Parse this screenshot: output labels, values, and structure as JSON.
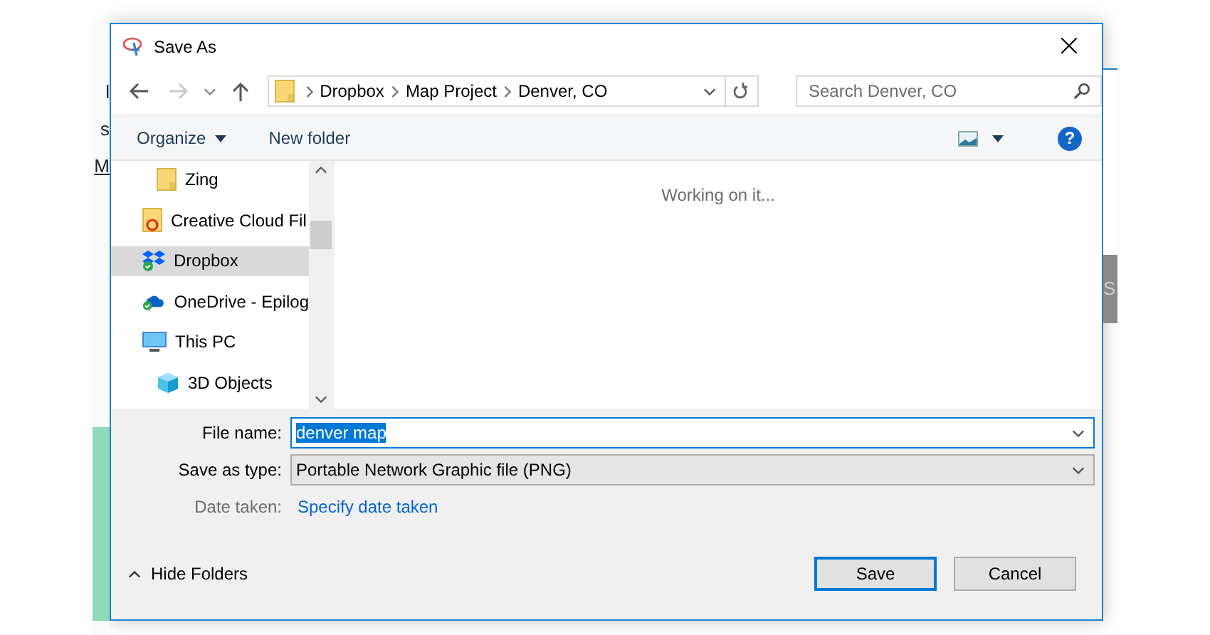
{
  "background_fragments": {
    "left": [
      "l",
      "s",
      "M"
    ],
    "right": [
      "S"
    ]
  },
  "window": {
    "title": "Save As",
    "close": "×"
  },
  "address": {
    "crumbs": [
      "Dropbox",
      "Map Project",
      "Denver, CO"
    ]
  },
  "search": {
    "placeholder": "Search Denver, CO"
  },
  "toolbar": {
    "organize": "Organize",
    "new_folder": "New folder",
    "help": "?"
  },
  "nav": {
    "items": [
      {
        "label": "Zing",
        "kind": "subfolder",
        "selected": false
      },
      {
        "label": "Creative Cloud Fil",
        "kind": "cloudfolder",
        "selected": false
      },
      {
        "label": "Dropbox",
        "kind": "dropbox",
        "selected": true
      },
      {
        "label": "OneDrive - Epilog",
        "kind": "onedrive",
        "selected": false
      },
      {
        "label": "This PC",
        "kind": "computer",
        "selected": false,
        "children": [
          {
            "label": "3D Objects",
            "kind": "objects",
            "selected": false
          }
        ]
      }
    ]
  },
  "content": {
    "status": "Working on it..."
  },
  "form": {
    "file_name": {
      "label": "File name:",
      "value": "denver map",
      "selected": true
    },
    "save_type": {
      "label": "Save as type:",
      "value": "Portable Network Graphic file (PNG)"
    },
    "date_taken": {
      "label": "Date taken:",
      "link": "Specify date taken"
    }
  },
  "footer": {
    "hide_folders": "Hide Folders",
    "buttons": [
      {
        "label": "Save",
        "default": true
      },
      {
        "label": "Cancel",
        "default": false
      }
    ]
  }
}
